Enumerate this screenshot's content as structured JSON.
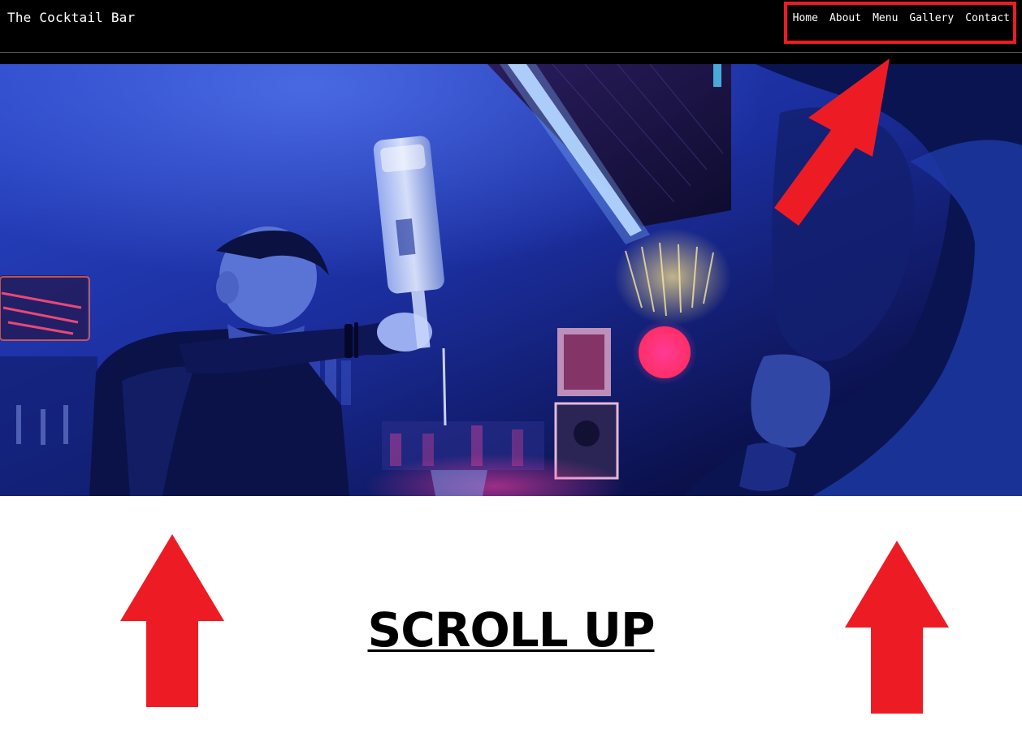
{
  "header": {
    "site_title": "The Cocktail Bar",
    "nav": [
      {
        "label": "Home"
      },
      {
        "label": "About"
      },
      {
        "label": "Menu"
      },
      {
        "label": "Gallery"
      },
      {
        "label": "Contact"
      }
    ]
  },
  "annotation": {
    "scroll_label": "SCROLL UP",
    "arrow_color": "#ed1c24"
  },
  "colors": {
    "navbar_bg": "#000000",
    "page_bg": "#ffffff",
    "hero_tint": "#1a2c9c"
  }
}
